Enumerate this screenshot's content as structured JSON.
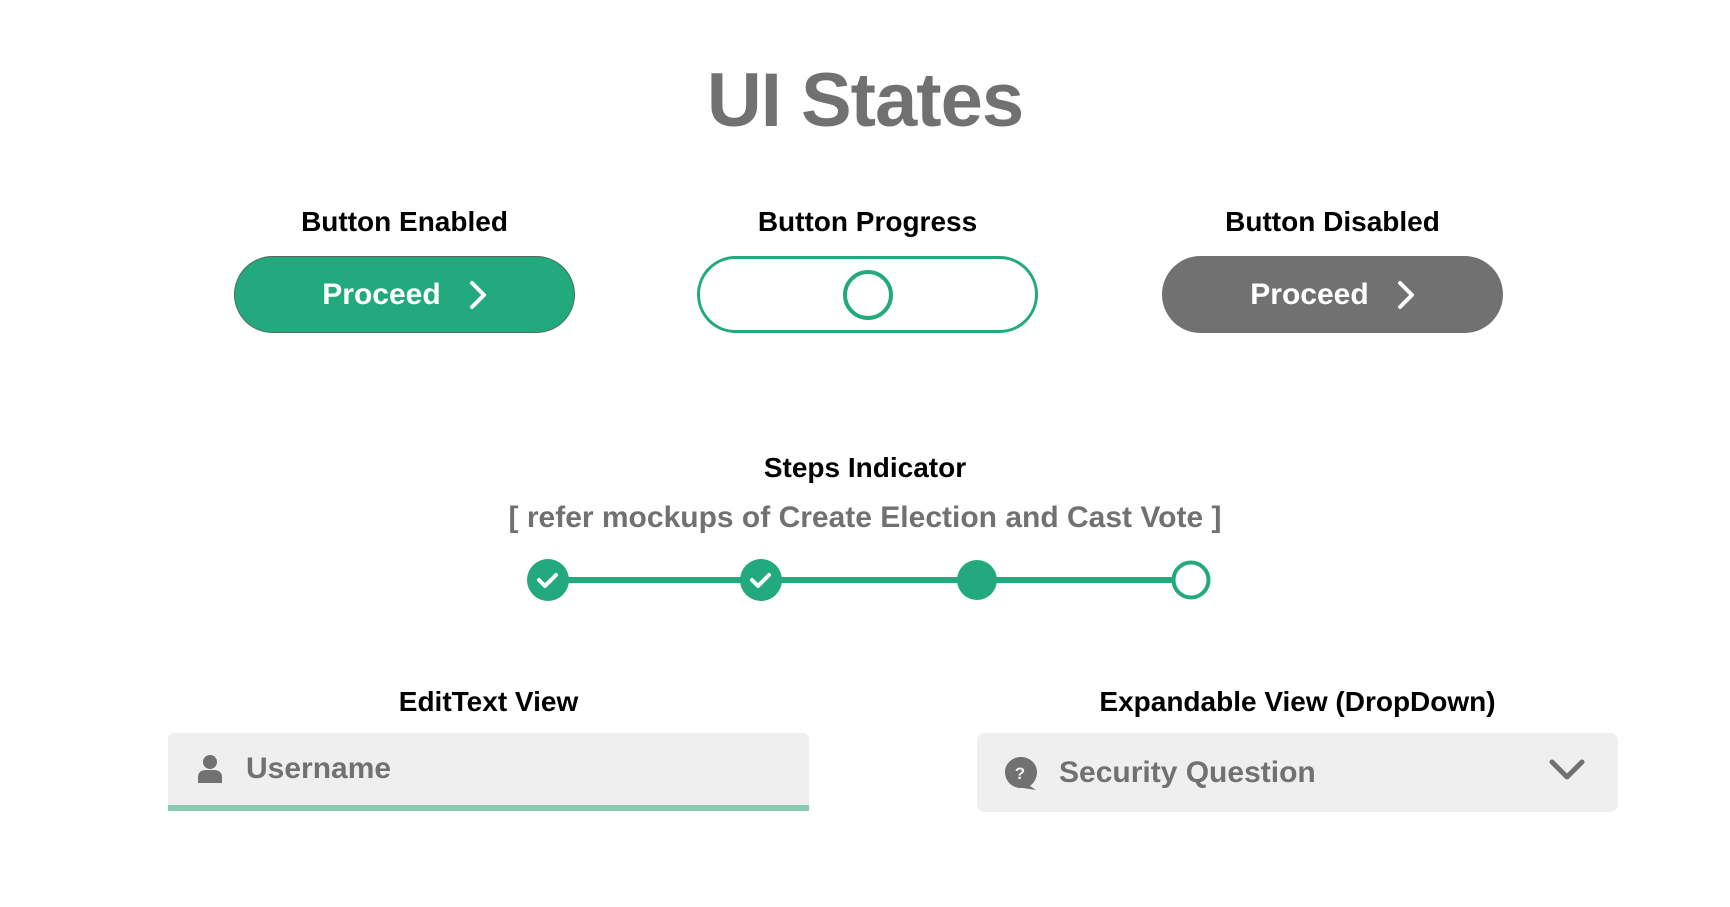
{
  "page": {
    "title": "UI States"
  },
  "colors": {
    "accent": "#22a97d",
    "disabled": "#717171",
    "field_bg": "#efefef",
    "underline": "#87cbb1",
    "text_dark": "#000000",
    "text_gray": "#717171"
  },
  "buttons": {
    "enabled": {
      "heading": "Button Enabled",
      "label": "Proceed",
      "icon": "chevron-right-icon"
    },
    "progress": {
      "heading": "Button Progress",
      "icon": "spinner-icon"
    },
    "disabled": {
      "heading": "Button Disabled",
      "label": "Proceed",
      "icon": "chevron-right-icon"
    }
  },
  "steps": {
    "heading": "Steps Indicator",
    "subtitle": "[ refer mockups of Create Election and Cast Vote ]",
    "items": [
      {
        "state": "completed",
        "icon": "check-icon"
      },
      {
        "state": "completed",
        "icon": "check-icon"
      },
      {
        "state": "current"
      },
      {
        "state": "pending"
      }
    ]
  },
  "edit_text": {
    "heading": "EditText View",
    "placeholder": "Username",
    "icon": "user-icon"
  },
  "dropdown": {
    "heading": "Expandable View (DropDown)",
    "selected": "Security Question",
    "icon": "question-bubble-icon",
    "expand_icon": "chevron-down-icon"
  }
}
